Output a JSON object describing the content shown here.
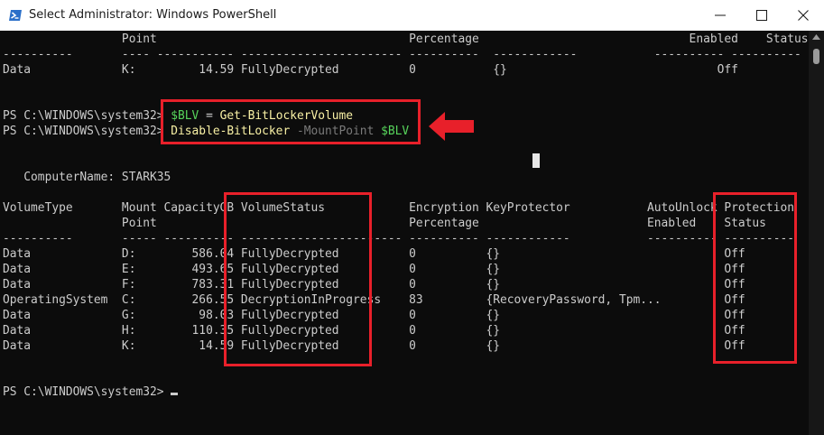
{
  "window": {
    "title": "Select Administrator: Windows PowerShell",
    "controls": [
      "minimize",
      "maximize",
      "close"
    ]
  },
  "console": {
    "lines": [
      [
        {
          "t": "                 Point                                    Percentage                              Enabled    Status",
          "c": "white"
        }
      ],
      [
        {
          "t": "----------       ---- ----------- ----------------------- ----------  ------------           ---------- ----------",
          "c": "white"
        }
      ],
      [
        {
          "t": "Data             K:         14.59 FullyDecrypted          0           {}                              Off",
          "c": "white"
        }
      ],
      [
        {
          "t": "",
          "c": "white"
        }
      ],
      [
        {
          "t": "PS C:\\WINDOWS\\system32> ",
          "c": "white"
        },
        {
          "t": "$BLV",
          "c": "var"
        },
        {
          "t": " = ",
          "c": "white"
        },
        {
          "t": "Get-BitLockerVolume",
          "c": "cmd"
        }
      ],
      [
        {
          "t": "PS C:\\WINDOWS\\system32> ",
          "c": "white"
        },
        {
          "t": "Disable-BitLocker",
          "c": "cmd"
        },
        {
          "t": " -MountPoint ",
          "c": "param"
        },
        {
          "t": "$BLV",
          "c": "var"
        }
      ],
      [
        {
          "t": "",
          "c": "white"
        }
      ],
      [
        {
          "t": "",
          "c": "white"
        }
      ],
      [
        {
          "t": "   ComputerName: STARK35",
          "c": "white"
        }
      ],
      [
        {
          "t": "",
          "c": "white"
        }
      ],
      [
        {
          "t": "VolumeType       Mount CapacityGB VolumeStatus            Encryption KeyProtector           AutoUnlock Protection",
          "c": "white"
        }
      ],
      [
        {
          "t": "                 Point                                    Percentage                        Enabled    Status",
          "c": "white"
        }
      ],
      [
        {
          "t": "----------       ----- ---------- ----------------------- ---------- ------------           ---------- ----------",
          "c": "white"
        }
      ],
      [
        {
          "t": "Data             D:        586.04 FullyDecrypted          0          {}                                Off",
          "c": "white"
        }
      ],
      [
        {
          "t": "Data             E:        493.65 FullyDecrypted          0          {}                                Off",
          "c": "white"
        }
      ],
      [
        {
          "t": "Data             F:        783.31 FullyDecrypted          0          {}                                Off",
          "c": "white"
        }
      ],
      [
        {
          "t": "OperatingSystem  C:        266.55 DecryptionInProgress    83         {RecoveryPassword, Tpm...         Off",
          "c": "white"
        }
      ],
      [
        {
          "t": "Data             G:         98.03 FullyDecrypted          0          {}                                Off",
          "c": "white"
        }
      ],
      [
        {
          "t": "Data             H:        110.35 FullyDecrypted          0          {}                                Off",
          "c": "white"
        }
      ],
      [
        {
          "t": "Data             K:         14.59 FullyDecrypted          0          {}                                Off",
          "c": "white"
        }
      ],
      [
        {
          "t": "",
          "c": "white"
        }
      ],
      [
        {
          "t": "",
          "c": "white"
        }
      ],
      [
        {
          "t": "PS C:\\WINDOWS\\system32> ",
          "c": "white"
        }
      ]
    ]
  },
  "annotations": {
    "highlight_color": "#e8202a",
    "arrow_color": "#e8202a"
  },
  "colors": {
    "console_bg": "#0c0c0c",
    "text": "#cccccc",
    "variable": "#57d45b",
    "command": "#f9f1a5",
    "parameter": "#7a7a7a"
  }
}
